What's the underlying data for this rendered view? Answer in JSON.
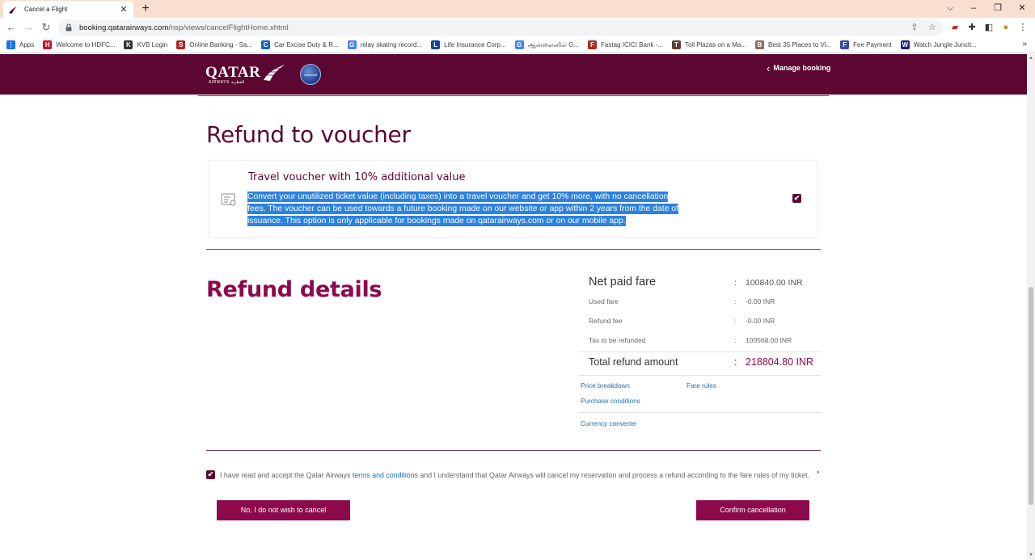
{
  "browser": {
    "tab_title": "Cancel a Flight",
    "new_tab_symbol": "+",
    "url_host": "booking.qatarairways.com",
    "url_path": "/nsp/views/cancelFlightHome.xhtml",
    "window_controls": {
      "dropdown": "⌵",
      "minimize": "–",
      "restore": "❐",
      "close": "✕"
    },
    "nav": {
      "back": "←",
      "forward": "→",
      "reload": "↻"
    }
  },
  "bookmarks": [
    {
      "label": "Apps",
      "color": "#1a73e8",
      "glyph": "⋮"
    },
    {
      "label": "Welcome to HDFC...",
      "color": "#c8102e",
      "glyph": "H"
    },
    {
      "label": "KVB Login",
      "color": "#333333",
      "glyph": "K"
    },
    {
      "label": "Online Banking - Sa...",
      "color": "#b3261e",
      "glyph": "S"
    },
    {
      "label": "Car Excise Duty & R...",
      "color": "#1565c0",
      "glyph": "C"
    },
    {
      "label": "relay skating record...",
      "color": "#4285f4",
      "glyph": "G"
    },
    {
      "label": "Life Insurance Corp...",
      "color": "#0d47a1",
      "glyph": "L"
    },
    {
      "label": "ஆன்லைனில் G...",
      "color": "#4285f4",
      "glyph": "G"
    },
    {
      "label": "Fastag ICICI Bank -...",
      "color": "#b3261e",
      "glyph": "F"
    },
    {
      "label": "Toll Plazas on a Ma...",
      "color": "#5d4037",
      "glyph": "T"
    },
    {
      "label": "Best 35 Places to Vi...",
      "color": "#8d6e63",
      "glyph": "B"
    },
    {
      "label": "Fee Payment",
      "color": "#3949ab",
      "glyph": "F"
    },
    {
      "label": "Watch Jungle Juncti...",
      "color": "#1a237e",
      "glyph": "W"
    }
  ],
  "bookmarks_more": "»",
  "site": {
    "brand": "QATAR",
    "brand_sub": "AIRWAYS القطرية",
    "alliance": "oneworld",
    "manage_booking": "Manage booking",
    "accent_color": "#5c0632"
  },
  "voucher": {
    "heading": "Refund to voucher",
    "option_title": "Travel voucher with 10% additional value",
    "option_desc": "Convert your unutilized ticket value (including taxes) into a travel voucher and get 10% more, with no cancellation fees. The voucher can be used towards a future booking made on our website or app within 2 years from the date of issuance. This option is only applicable for bookings made on qatarairways.com or on our mobile app.",
    "checked": true,
    "check_glyph": "✔"
  },
  "refund": {
    "heading": "Refund details",
    "rows": [
      {
        "label": "Net paid fare",
        "colon": ":",
        "value": "100840.00 INR"
      },
      {
        "label": "Used fare",
        "colon": ":",
        "value": "-0.00 INR"
      },
      {
        "label": "Refund fee",
        "colon": ":",
        "value": "-0.00 INR"
      },
      {
        "label": "Tax to be refunded",
        "colon": ":",
        "value": "100568.00 INR"
      },
      {
        "label": "Total refund amount",
        "colon": ":",
        "value": "218804.80 INR"
      }
    ],
    "links": {
      "price_breakdown": "Price breakdown",
      "fare_rules": "Fare rules",
      "purchase_conditions": "Purchase conditions",
      "currency_converter": "Currency converter"
    }
  },
  "consent": {
    "text_before": "I have read and accept the Qatar Airways ",
    "link": "terms and conditions",
    "text_after": " and I understand that Qatar Airways will cancel my reservation and process a refund according to the fare rules of my ticket.",
    "required_mark": "*",
    "checked": true
  },
  "actions": {
    "no_cancel": "No, I do not wish to cancel",
    "confirm": "Confirm cancellation"
  }
}
